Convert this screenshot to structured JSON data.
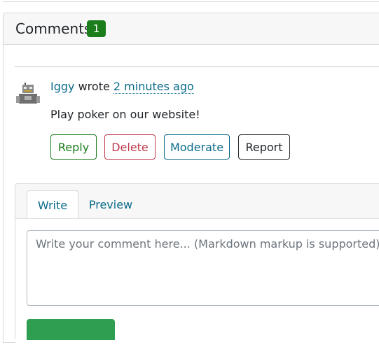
{
  "comments": {
    "title": "Comments",
    "count": "1"
  },
  "comment": {
    "author": "Iggy",
    "wrote": "wrote",
    "time": "2 minutes ago",
    "body": "Play poker on our website!",
    "actions": {
      "reply": "Reply",
      "delete": "Delete",
      "moderate": "Moderate",
      "report": "Report"
    },
    "avatar_icon": "robot-avatar-icon"
  },
  "editor": {
    "tabs": [
      "Write",
      "Preview"
    ],
    "active_tab": "Write",
    "placeholder": "Write your comment here... (Markdown markup is supported)",
    "value": ""
  },
  "colors": {
    "success": "#1b7d1b",
    "danger": "#c0394b",
    "link": "#0b6b8a",
    "submit": "#2e9e50"
  }
}
